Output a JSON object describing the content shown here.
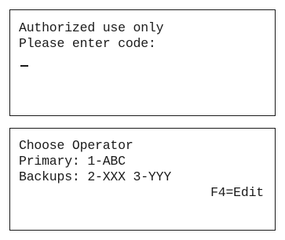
{
  "auth_screen": {
    "line1": "Authorized use only",
    "line2": "Please enter code:",
    "cursor": "_"
  },
  "operator_screen": {
    "title": "Choose Operator",
    "primary": "Primary: 1-ABC",
    "backups": "Backups: 2-XXX 3-YYY",
    "softkey": "F4=Edit"
  }
}
